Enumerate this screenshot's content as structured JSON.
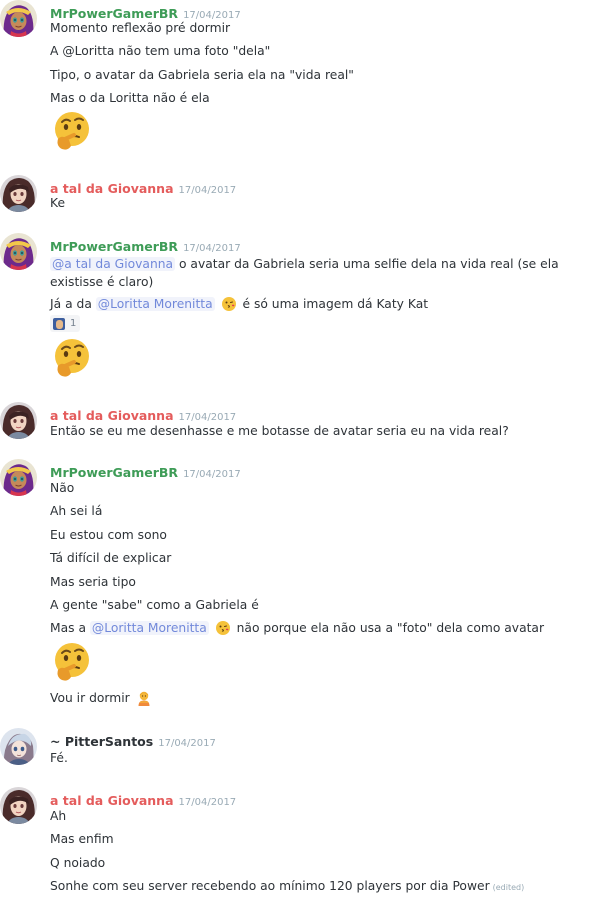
{
  "colors": {
    "power_name": "#3e9c57",
    "giovanna_name": "#e45c5c",
    "pitter_name": "#2e3338",
    "mention": "#7289da",
    "timestamp": "#99aab5"
  },
  "groups": [
    {
      "username": "MrPowerGamerBR",
      "timestamp": "17/04/2017",
      "avatar_icon": "shantae-avatar-icon",
      "lines": [
        "Momento reflexão pré dormir",
        "A @Loritta não tem uma foto \"dela\"",
        "Tipo, o avatar da Gabriela seria ela na \"vida real\"",
        "Mas o da Loritta não é ela"
      ],
      "emoji": "thinking-face-emoji"
    },
    {
      "username": "a tal da Giovanna",
      "timestamp": "17/04/2017",
      "avatar_icon": "giovanna-avatar-icon",
      "lines": [
        "Ke"
      ]
    },
    {
      "username": "MrPowerGamerBR",
      "timestamp": "17/04/2017",
      "avatar_icon": "shantae-avatar-icon",
      "line1": {
        "mention": "@a tal da Giovanna",
        "text": " o avatar da Gabriela seria uma selfie dela na vida real (se ela existisse é claro)"
      },
      "line2": {
        "pre": "Já a da ",
        "mention": "@Loritta Morenitta",
        "post": " é só uma imagem dá Katy Kat"
      },
      "reaction_count": "1",
      "emoji": "thinking-face-emoji"
    },
    {
      "username": "a tal da Giovanna",
      "timestamp": "17/04/2017",
      "avatar_icon": "giovanna-avatar-icon",
      "lines": [
        "Então se eu me desenhasse e me botasse de avatar seria eu na vida real?"
      ]
    },
    {
      "username": "MrPowerGamerBR",
      "timestamp": "17/04/2017",
      "avatar_icon": "shantae-avatar-icon",
      "lines": [
        "Não",
        "Ah sei lá",
        "Eu estou com sono",
        "Tá difícil de explicar",
        "Mas seria tipo",
        "A gente \"sabe\" como a Gabriela é"
      ],
      "mention_line": {
        "pre": "Mas a ",
        "mention": "@Loritta Morenitta",
        "post": " não porque ela não usa a \"foto\" dela como avatar"
      },
      "emoji": "thinking-face-emoji",
      "last_line": "Vou ir dormir"
    },
    {
      "username": "~ PitterSantos",
      "timestamp": "17/04/2017",
      "avatar_icon": "pitter-avatar-icon",
      "lines": [
        "Fé."
      ]
    },
    {
      "username": "a tal da Giovanna",
      "timestamp": "17/04/2017",
      "avatar_icon": "giovanna-avatar-icon",
      "lines": [
        "Ah",
        "Mas enfim",
        "Q noiado",
        "Sonhe com seu server recebendo ao mínimo 120 players por dia Power"
      ],
      "edited": "(edited)"
    }
  ]
}
